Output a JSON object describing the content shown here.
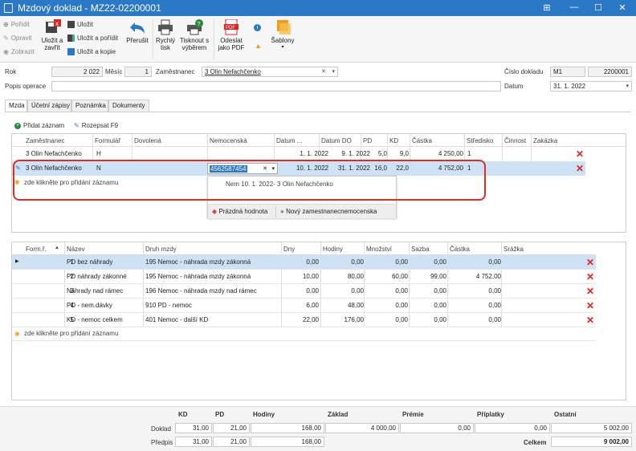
{
  "window": {
    "title": "Mzdový doklad - MZ22-02200001"
  },
  "ribbon": {
    "add": "Pořídit",
    "edit": "Opravit",
    "view": "Zobrazit",
    "save_close": "Uložit a zavřít",
    "save": "Uložit",
    "save_add": "Uložit a pořídit",
    "save_copy": "Uložit a kopie",
    "abort": "Přerušit",
    "quick_print": "Rychlý tisk",
    "print_select": "Tisknout s výběrem",
    "send_pdf": "Odeslat jako PDF",
    "templates": "Šablony"
  },
  "form": {
    "rok_label": "Rok",
    "rok": "2 022",
    "mesic_label": "Měsíc",
    "mesic": "1",
    "zam_label": "Zaměstnanec",
    "zam": "3 Olin Nefachčenko",
    "popis_label": "Popis operace",
    "popis": "",
    "cislo_label": "Číslo dokladu",
    "cislo_prefix": "M1",
    "cislo": "2200001",
    "datum_label": "Datum",
    "datum": "31. 1. 2022"
  },
  "tabs": [
    "Mzda",
    "Účetní zápisy",
    "Poznámka",
    "Dokumenty"
  ],
  "toolbar": {
    "add_record": "Přidat záznam",
    "transcribe": "Rozepsat F9"
  },
  "grid1": {
    "headers": [
      "Zaměstnanec",
      "Formulář",
      "Dovolená",
      "Nemocenská",
      "Datum ...",
      "Datum DO",
      "PD",
      "KD",
      "Částka",
      "Středisko",
      "Činnost",
      "Zakázka"
    ],
    "rows": [
      {
        "emp": "3 Olin Nefachčenko",
        "form": "H",
        "dov": "",
        "nem": "",
        "dod": "1. 1. 2022",
        "ddo": "9. 1. 2022",
        "pd": "5,0",
        "kd": "9,0",
        "castka": "4 250,00",
        "str": "1"
      },
      {
        "emp": "3 Olin Nefachčenko",
        "form": "N",
        "dov": "",
        "nem": "4562587454",
        "dod": "10. 1. 2022",
        "ddo": "31. 1. 2022",
        "pd": "16,0",
        "kd": "22,0",
        "castka": "4 752,00",
        "str": "1"
      }
    ],
    "add_hint": "zde klikněte pro přidání záznamu"
  },
  "popup": {
    "item": "Nem 10. 1. 2022- 3 Olin Nefachčenko",
    "empty": "Prázdná hodnota",
    "new": "Nový zamestnanecnemocenska"
  },
  "grid2": {
    "headers": [
      "Form.ř.",
      "Název",
      "Druh mzdy",
      "Dny",
      "Hodiny",
      "Množství",
      "Sazba",
      "Částka",
      "Srážka"
    ],
    "rows": [
      {
        "fr": "1",
        "nazev": "PD bez náhrady",
        "druh": "195 Nemoc - náhrada mzdy zákonná",
        "dny": "0,00",
        "hod": "0,00",
        "mn": "0,00",
        "sazba": "0,00",
        "castka": "0,00"
      },
      {
        "fr": "2",
        "nazev": "PD náhrady zákonné",
        "druh": "195 Nemoc - náhrada mzdy zákonná",
        "dny": "10,00",
        "hod": "80,00",
        "mn": "60,00",
        "sazba": "99,00",
        "castka": "4 752,00"
      },
      {
        "fr": "3",
        "nazev": "Náhrady nad rámec",
        "druh": "196 Nemoc - náhrada mzdy nad rámec",
        "dny": "0,00",
        "hod": "0,00",
        "mn": "0,00",
        "sazba": "0,00",
        "castka": "0,00"
      },
      {
        "fr": "4",
        "nazev": "PD - nem.dávky",
        "druh": "910 PD - nemoc",
        "dny": "6,00",
        "hod": "48,00",
        "mn": "0,00",
        "sazba": "0,00",
        "castka": "0,00"
      },
      {
        "fr": "5",
        "nazev": "KD - nemoc celkem",
        "druh": "401 Nemoc - další KD",
        "dny": "22,00",
        "hod": "176,00",
        "mn": "0,00",
        "sazba": "0,00",
        "castka": "0,00"
      }
    ],
    "add_hint": "zde klikněte pro přidání záznamu"
  },
  "summary": {
    "headers": [
      "KD",
      "PD",
      "Hodiny",
      "Základ",
      "Prémie",
      "Příplatky",
      "Ostatní"
    ],
    "doklad_label": "Doklad",
    "predpis_label": "Předpis",
    "celkem_label": "Celkem",
    "doklad": [
      "31,00",
      "21,00",
      "168,00",
      "4 000,00",
      "0,00",
      "0,00",
      "5 002,00"
    ],
    "predpis": [
      "31,00",
      "21,00",
      "168,00"
    ],
    "celkem": "9 002,00"
  },
  "colors": {
    "titlebar": "#2b78c6",
    "selected_row": "#cfe2f5",
    "highlight": "#d93025",
    "delete": "#dd2222"
  }
}
